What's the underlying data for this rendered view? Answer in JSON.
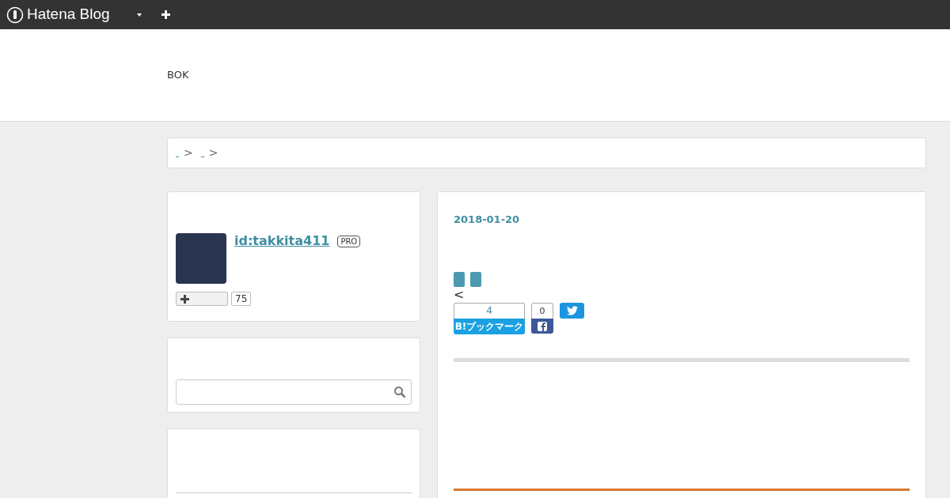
{
  "top_bar": {
    "logo": "Hatena Blog"
  },
  "header": {
    "blog_title": "BOK"
  },
  "breadcrumb": {
    "separators": [
      ">",
      ">"
    ]
  },
  "profile": {
    "user_id": "id:takkita411",
    "badge": "PRO",
    "follower_count": "75"
  },
  "entry": {
    "date": "2018-01-20",
    "symbol": "<",
    "bookmark_count": "4",
    "bookmark_label": "B!ブックマーク",
    "facebook_count": "0"
  }
}
